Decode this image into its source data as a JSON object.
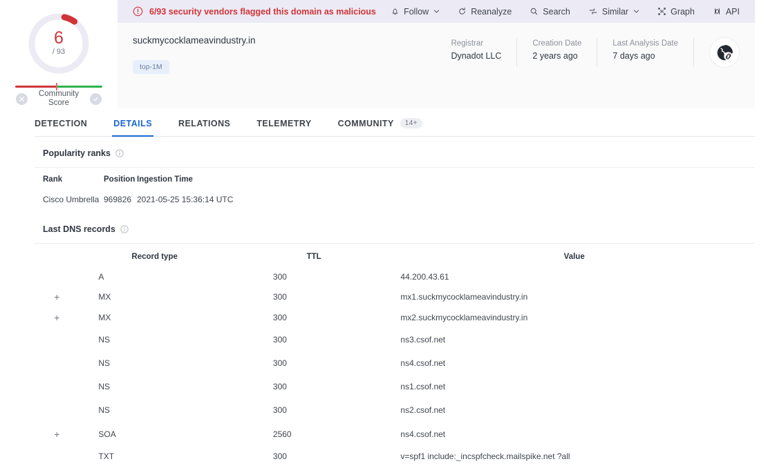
{
  "score": {
    "value": "6",
    "total": "/ 93",
    "arc_percent": 6.5,
    "color": "#d13438",
    "community_label_line1": "Community",
    "community_label_line2": "Score",
    "negative_icon": "x-circle-icon",
    "positive_icon": "check-circle-icon"
  },
  "alert": {
    "icon": "exclamation-circle-icon",
    "text": "6/93 security vendors flagged this domain as malicious",
    "color": "#d13438",
    "background": "#eceaf5"
  },
  "toolbar": [
    {
      "label": "Follow",
      "icon": "bell-icon",
      "chevron": true
    },
    {
      "label": "Reanalyze",
      "icon": "refresh-icon",
      "chevron": false
    },
    {
      "label": "Search",
      "icon": "search-icon",
      "chevron": false
    },
    {
      "label": "Similar",
      "icon": "similar-icon",
      "chevron": true
    },
    {
      "label": "Graph",
      "icon": "graph-icon",
      "chevron": false
    },
    {
      "label": "API",
      "icon": "api-icon",
      "chevron": false
    }
  ],
  "entity": {
    "domain": "suckmycocklameavindustry.in",
    "tag": "top-1M",
    "type_icon": "globe-link-icon"
  },
  "meta": [
    {
      "key": "Registrar",
      "value": "Dynadot LLC"
    },
    {
      "key": "Creation Date",
      "value": "2 years ago"
    },
    {
      "key": "Last Analysis Date",
      "value": "7 days ago"
    }
  ],
  "tabs": [
    {
      "label": "DETECTION",
      "active": false,
      "badge": ""
    },
    {
      "label": "DETAILS",
      "active": true,
      "badge": ""
    },
    {
      "label": "RELATIONS",
      "active": false,
      "badge": ""
    },
    {
      "label": "TELEMETRY",
      "active": false,
      "badge": ""
    },
    {
      "label": "COMMUNITY",
      "active": false,
      "badge": "14+"
    }
  ],
  "popularity": {
    "title": "Popularity ranks",
    "info_icon": "info-icon",
    "columns": [
      "Rank",
      "Position",
      "Ingestion Time"
    ],
    "rows": [
      {
        "rank": "Cisco Umbrella",
        "position": "969826",
        "ingestion": "2021-05-25 15:36:14 UTC"
      }
    ]
  },
  "dns": {
    "title": "Last DNS records",
    "info_icon": "info-icon",
    "columns": [
      "Record type",
      "TTL",
      "Value"
    ],
    "expand_glyph": "+",
    "rows": [
      {
        "expandable": false,
        "type": "A",
        "ttl": "300",
        "value": "44.200.43.61"
      },
      {
        "expandable": true,
        "type": "MX",
        "ttl": "300",
        "value": "mx1.suckmycocklameavindustry.in"
      },
      {
        "expandable": true,
        "type": "MX",
        "ttl": "300",
        "value": "mx2.suckmycocklameavindustry.in"
      },
      {
        "expandable": false,
        "type": "NS",
        "ttl": "300",
        "value": "ns3.csof.net"
      },
      {
        "expandable": false,
        "type": "NS",
        "ttl": "300",
        "value": "ns4.csof.net"
      },
      {
        "expandable": false,
        "type": "NS",
        "ttl": "300",
        "value": "ns1.csof.net"
      },
      {
        "expandable": false,
        "type": "NS",
        "ttl": "300",
        "value": "ns2.csof.net"
      },
      {
        "expandable": true,
        "type": "SOA",
        "ttl": "2560",
        "value": "ns4.csof.net"
      },
      {
        "expandable": false,
        "type": "TXT",
        "ttl": "300",
        "value": "v=spf1 include:_incspfcheck.mailspike.net ?all"
      }
    ]
  }
}
